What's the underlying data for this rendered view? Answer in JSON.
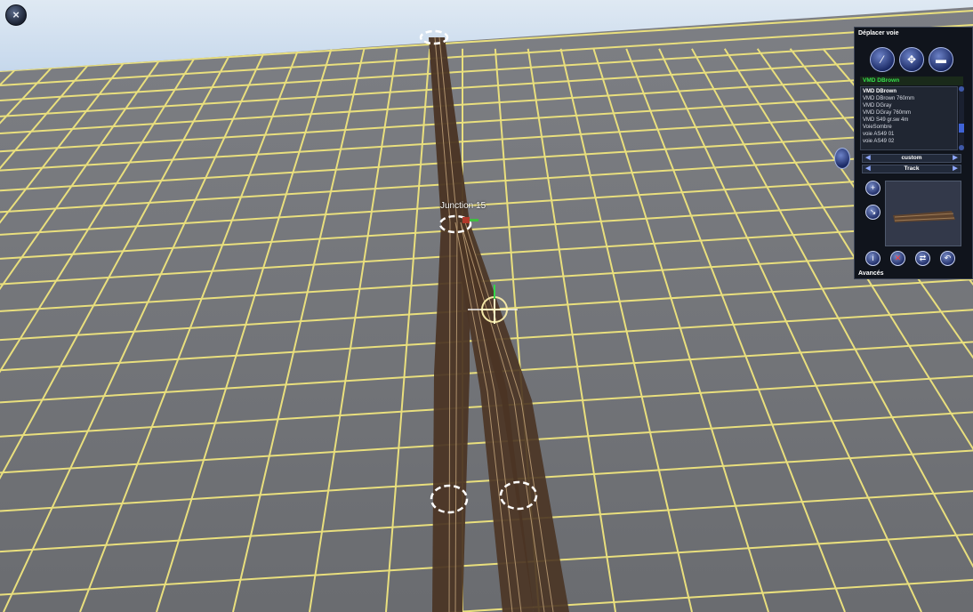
{
  "viewport": {
    "junction_label": "Junction 15",
    "close_glyph": "×"
  },
  "panel": {
    "title": "Déplacer voie",
    "tools": [
      "track-tool-icon",
      "move-tool-icon",
      "delete-tool-icon"
    ],
    "selected_track": "VMD DBrown",
    "track_list": [
      "VMD DBrown",
      "VMD DBrown 760mm",
      "VMD DGray",
      "VMD DGray 760mm",
      "VMD S49 gr.sw 4m",
      "VoieSombre",
      "voie AS49 01",
      "voie AS49 02"
    ],
    "category_value": "custom",
    "type_value": "Track",
    "footer_label": "Avancés"
  }
}
